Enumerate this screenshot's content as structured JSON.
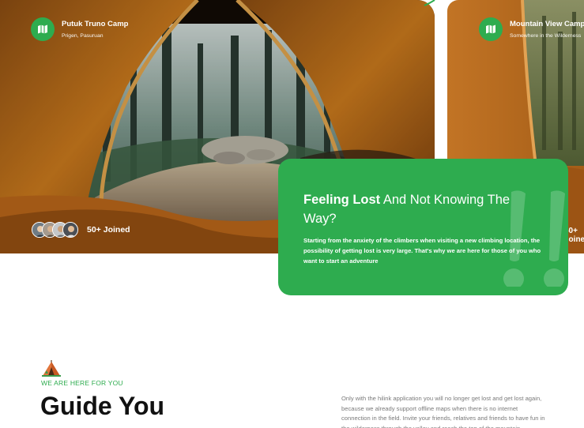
{
  "camps": [
    {
      "name": "Putuk Truno Camp",
      "location": "Prigen, Pasuruan",
      "joined": "50+ Joined",
      "map_icon": "map-icon"
    },
    {
      "name": "Mountain View Camp",
      "location": "Somewhere in the Wilderness",
      "joined": "50+ Joined",
      "map_icon": "map-icon"
    }
  ],
  "info_card": {
    "title_bold": "Feeling Lost",
    "title_rest": " And Not Knowing The Way?",
    "body": "Starting from the anxiety of the climbers when visiting a new climbing location, the possibility of getting lost is very large. That's why we are here for those of you who want to start an adventure",
    "icon": "quote-icon"
  },
  "section": {
    "eyebrow": "WE ARE HERE FOR YOU",
    "title": "Guide You",
    "description": "Only with the hilink application you will no longer get lost and get lost again, because we already support offline maps when there is no internet connection in the field. Invite your friends, relatives and friends to have fun in the wilderness through the valley and reach the top of the mountain",
    "icon": "tent-icon"
  },
  "colors": {
    "accent": "#2eac4f",
    "text": "#111111",
    "muted": "#7a7a7a"
  }
}
